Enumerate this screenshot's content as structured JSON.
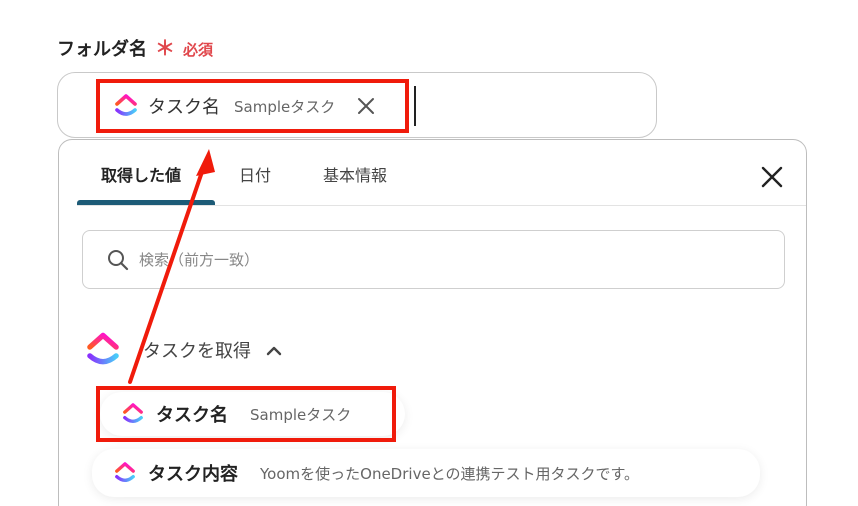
{
  "field": {
    "label": "フォルダ名",
    "required_mark": "＊",
    "required_text": "必須"
  },
  "chip": {
    "name": "タスク名",
    "value": "Sampleタスク"
  },
  "tabs": [
    {
      "label": "取得した値",
      "active": true
    },
    {
      "label": "日付",
      "active": false
    },
    {
      "label": "基本情報",
      "active": false
    }
  ],
  "search": {
    "placeholder": "検索（前方一致）"
  },
  "group": {
    "title": "タスクを取得"
  },
  "items": [
    {
      "name": "タスク名",
      "value": "Sampleタスク"
    },
    {
      "name": "タスク内容",
      "value": "Yoomを使ったOneDriveとの連携テスト用タスクです。"
    }
  ],
  "colors": {
    "annotation_red": "#f01b0b",
    "tab_underline": "#1d5b77",
    "required_red": "#e0474c"
  },
  "icons": {
    "app": "clickup-logo-icon",
    "close": "close-icon",
    "search": "search-icon",
    "collapse": "chevron-up-icon"
  }
}
